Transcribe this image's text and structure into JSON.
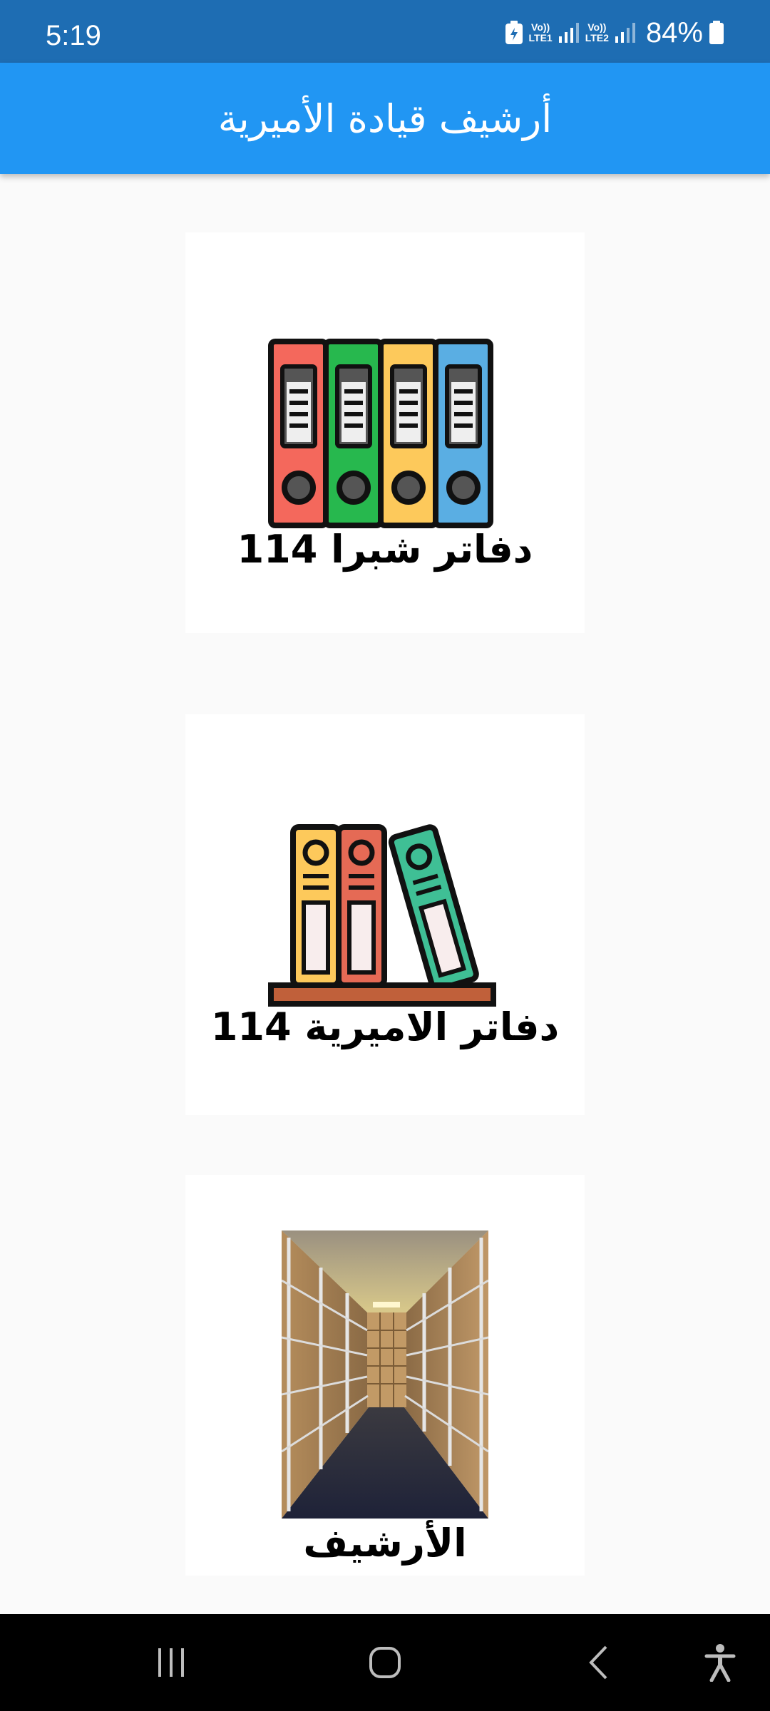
{
  "status_bar": {
    "time": "5:19",
    "sim1_top": "Vo))",
    "sim1_bottom": "LTE1",
    "sim2_top": "Vo))",
    "sim2_bottom": "LTE2",
    "battery": "84%"
  },
  "app_bar": {
    "title": "أرشيف قيادة الأميرية"
  },
  "cards": [
    {
      "label": "دفاتر شبرا 114",
      "icon": "binders-icon"
    },
    {
      "label": "دفاتر الاميرية 114",
      "icon": "shelf-binders-icon"
    },
    {
      "label": "الأرشيف",
      "icon": "archive-photo"
    }
  ],
  "nav_bar": {
    "recents": "recents-icon",
    "home": "home-icon",
    "back": "back-icon",
    "accessibility": "accessibility-icon"
  },
  "colors": {
    "status_bar": "#1e6db3",
    "app_bar": "#2196f3",
    "background": "#fafafa",
    "binder_red": "#f4685c",
    "binder_green": "#27b84e",
    "binder_yellow": "#fdc95b",
    "binder_blue": "#5aaee3",
    "binder_teal": "#3fbf95",
    "shelf_brown": "#c0603a"
  }
}
